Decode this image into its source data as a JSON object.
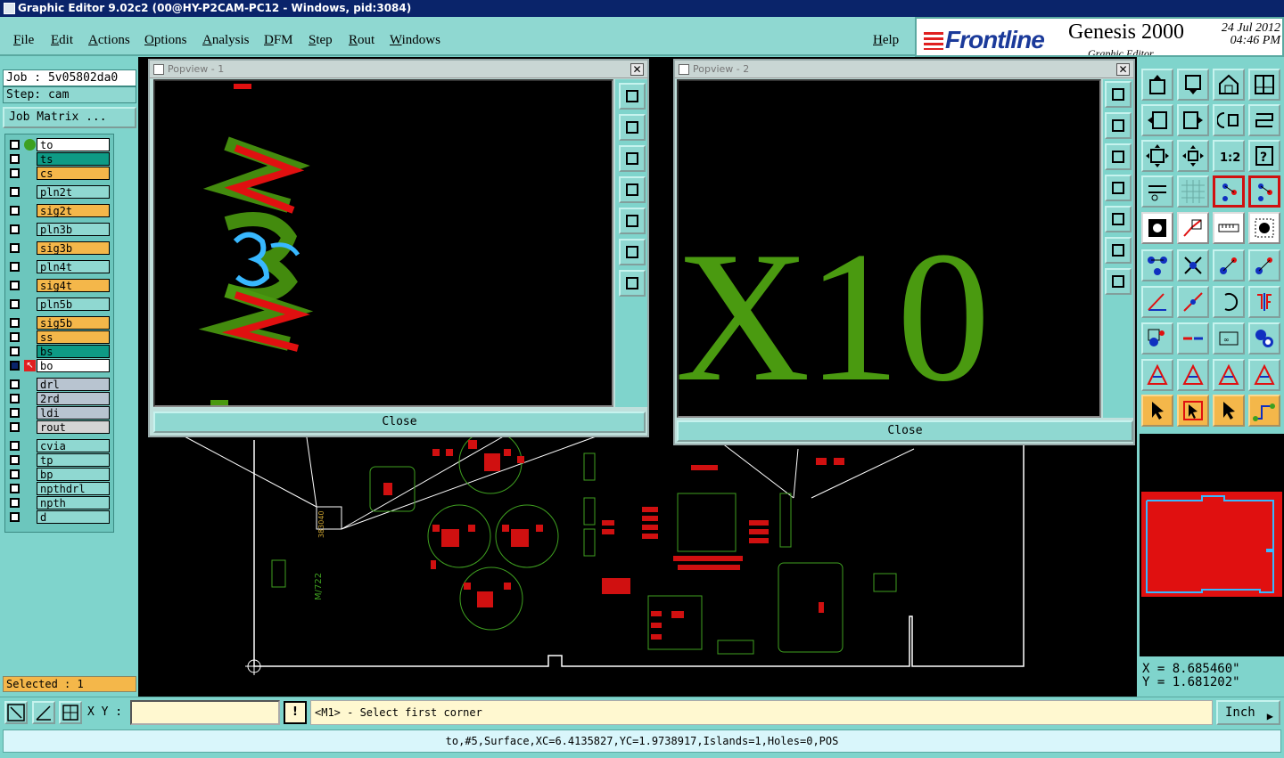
{
  "window": {
    "title": "Graphic Editor 9.02c2 (00@HY-P2CAM-PC12 - Windows, pid:3084)"
  },
  "menu": {
    "items": [
      "File",
      "Edit",
      "Actions",
      "Options",
      "Analysis",
      "DFM",
      "Step",
      "Rout",
      "Windows"
    ],
    "help": "Help"
  },
  "logo": {
    "brand": "Frontline",
    "product": "Genesis 2000",
    "subtitle": "Graphic Editor",
    "date": "24 Jul 2012",
    "time": "04:46 PM"
  },
  "job": {
    "job_line": "Job : 5v05802da0",
    "step_line": "Step: cam",
    "matrix_button": "Job Matrix ..."
  },
  "layers": [
    {
      "name": "to",
      "color": "#ffffff"
    },
    {
      "name": "ts",
      "color": "#0e9a85"
    },
    {
      "name": "cs",
      "color": "#f4b74a"
    },
    {
      "name": "pln2t",
      "color": "#8fd8d1"
    },
    {
      "name": "sig2t",
      "color": "#f4b74a"
    },
    {
      "name": "pln3b",
      "color": "#8fd8d1"
    },
    {
      "name": "sig3b",
      "color": "#f4b74a"
    },
    {
      "name": "pln4t",
      "color": "#8fd8d1"
    },
    {
      "name": "sig4t",
      "color": "#f4b74a"
    },
    {
      "name": "pln5b",
      "color": "#8fd8d1"
    },
    {
      "name": "sig5b",
      "color": "#f4b74a"
    },
    {
      "name": "ss",
      "color": "#f4b74a"
    },
    {
      "name": "bs",
      "color": "#0e9a85"
    },
    {
      "name": "bo",
      "color": "#ffffff"
    },
    {
      "name": "drl",
      "color": "#b8c4d0"
    },
    {
      "name": "2rd",
      "color": "#b8c4d0"
    },
    {
      "name": "ldi",
      "color": "#b8c4d0"
    },
    {
      "name": "rout",
      "color": "#d4d4d4"
    },
    {
      "name": "cvia",
      "color": "#8fd8d1"
    },
    {
      "name": "tp",
      "color": "#8fd8d1"
    },
    {
      "name": "bp",
      "color": "#8fd8d1"
    },
    {
      "name": "npthdrl",
      "color": "#8fd8d1"
    },
    {
      "name": "npth",
      "color": "#8fd8d1"
    },
    {
      "name": "d",
      "color": "#8fd8d1"
    }
  ],
  "selected": "Selected : 1",
  "popview1": {
    "title": "Popview - 1",
    "close_label": "Close",
    "close_x": "✕"
  },
  "popview2": {
    "title": "Popview - 2",
    "close_label": "Close",
    "close_x": "✕",
    "big_text": "X10"
  },
  "coords": {
    "x": "X = 8.685460\"",
    "y": "Y = 1.681202\""
  },
  "bottom": {
    "xy_label": "X Y :",
    "xy_value": "",
    "warn": "!",
    "prompt": "<M1> - Select first corner",
    "unit": "Inch"
  },
  "status": "to,#5,Surface,XC=6.4135827,YC=1.9738917,Islands=1,Holes=0,POS",
  "colors": {
    "panel": "#7fd4cc",
    "canvas": "#000000",
    "trace_green": "#4a9a10",
    "trace_red": "#e01010",
    "highlight_blue": "#38b8ff"
  }
}
